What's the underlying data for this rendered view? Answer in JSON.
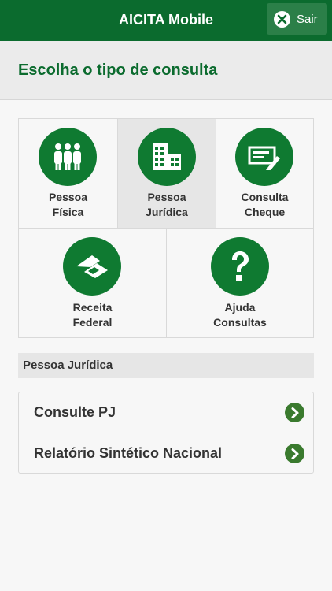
{
  "header": {
    "title": "AICITA Mobile",
    "logout_label": "Sair"
  },
  "page": {
    "title": "Escolha o tipo de consulta"
  },
  "menu": [
    {
      "line1": "Pessoa",
      "line2": "Física",
      "icon": "people-icon"
    },
    {
      "line1": "Pessoa",
      "line2": "Jurídica",
      "icon": "buildings-icon",
      "selected": true
    },
    {
      "line1": "Consulta",
      "line2": "Cheque",
      "icon": "cheque-icon"
    },
    {
      "line1": "Receita",
      "line2": "Federal",
      "icon": "receita-federal-icon"
    },
    {
      "line1": "Ajuda",
      "line2": "Consultas",
      "icon": "help-icon"
    }
  ],
  "section": {
    "title": "Pessoa Jurídica"
  },
  "options": [
    {
      "label": "Consulte PJ",
      "icon": "chevron-right-icon"
    },
    {
      "label": "Relatório Sintético Nacional",
      "icon": "chevron-right-icon"
    }
  ],
  "colors": {
    "brand": "#0b6b2e",
    "icon_bg": "#0f7a31",
    "chevron": "#3a7a2e"
  }
}
